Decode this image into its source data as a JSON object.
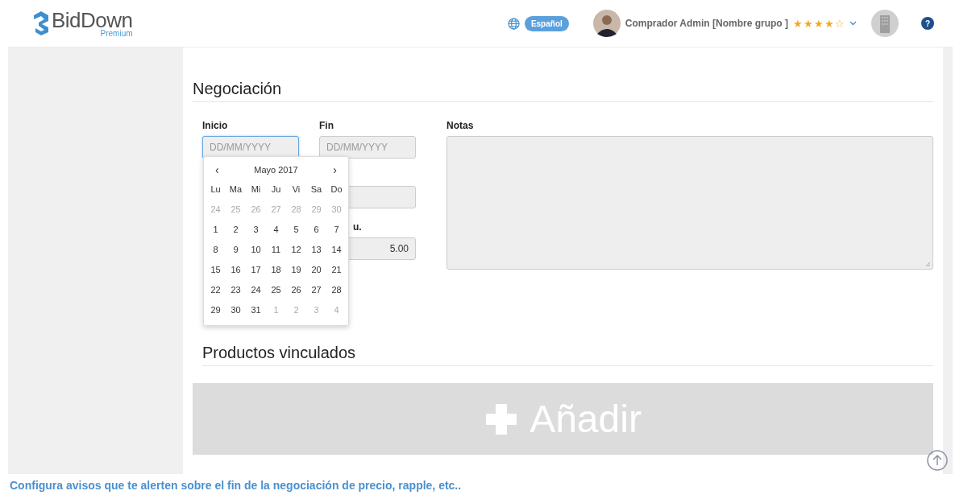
{
  "header": {
    "logo": {
      "name": "BidDown",
      "tier": "Premium"
    },
    "language": "Español",
    "user": {
      "name": "Comprador Admin [Nombre grupo ]",
      "stars": 4
    },
    "help": "?"
  },
  "negotiation": {
    "title": "Negociación",
    "start": {
      "label": "Inicio",
      "placeholder": "DD/MM/YYYY"
    },
    "end": {
      "label": "Fin",
      "placeholder": "DD/MM/YYYY"
    },
    "hidden_field": {
      "label": "u.",
      "value": "5.00"
    },
    "notes": {
      "label": "Notas"
    },
    "calendar": {
      "month": "Mayo 2017",
      "prev": "‹",
      "next": "›",
      "weekdays": [
        "Lu",
        "Ma",
        "Mi",
        "Ju",
        "Vi",
        "Sa",
        "Do"
      ],
      "days": [
        {
          "day": "24",
          "muted": true
        },
        {
          "day": "25",
          "muted": true
        },
        {
          "day": "26",
          "muted": true
        },
        {
          "day": "27",
          "muted": true
        },
        {
          "day": "28",
          "muted": true
        },
        {
          "day": "29",
          "muted": true
        },
        {
          "day": "30",
          "muted": true
        },
        {
          "day": "1",
          "muted": false
        },
        {
          "day": "2",
          "muted": false
        },
        {
          "day": "3",
          "muted": false
        },
        {
          "day": "4",
          "muted": false
        },
        {
          "day": "5",
          "muted": false
        },
        {
          "day": "6",
          "muted": false
        },
        {
          "day": "7",
          "muted": false
        },
        {
          "day": "8",
          "muted": false
        },
        {
          "day": "9",
          "muted": false
        },
        {
          "day": "10",
          "muted": false
        },
        {
          "day": "11",
          "muted": false
        },
        {
          "day": "12",
          "muted": false
        },
        {
          "day": "13",
          "muted": false
        },
        {
          "day": "14",
          "muted": false
        },
        {
          "day": "15",
          "muted": false
        },
        {
          "day": "16",
          "muted": false
        },
        {
          "day": "17",
          "muted": false
        },
        {
          "day": "18",
          "muted": false
        },
        {
          "day": "19",
          "muted": false
        },
        {
          "day": "20",
          "muted": false
        },
        {
          "day": "21",
          "muted": false
        },
        {
          "day": "22",
          "muted": false
        },
        {
          "day": "23",
          "muted": false
        },
        {
          "day": "24",
          "muted": false
        },
        {
          "day": "25",
          "muted": false
        },
        {
          "day": "26",
          "muted": false
        },
        {
          "day": "27",
          "muted": false
        },
        {
          "day": "28",
          "muted": false
        },
        {
          "day": "29",
          "muted": false
        },
        {
          "day": "30",
          "muted": false
        },
        {
          "day": "31",
          "muted": false
        },
        {
          "day": "1",
          "muted": true
        },
        {
          "day": "2",
          "muted": true
        },
        {
          "day": "3",
          "muted": true
        },
        {
          "day": "4",
          "muted": true
        }
      ]
    }
  },
  "products": {
    "title": "Productos vinculados",
    "add": "Añadir"
  },
  "caption": "Configura avisos que te alerten sobre el fin de la negociación de precio, rapple, etc.."
}
